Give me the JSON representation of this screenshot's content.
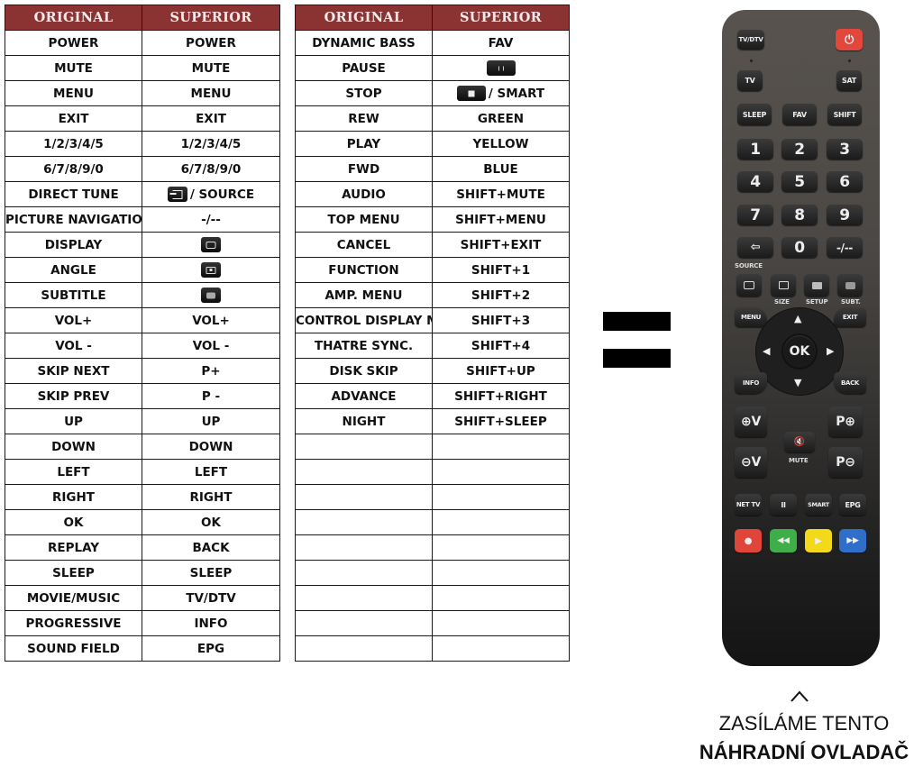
{
  "headers": {
    "original": "ORIGINAL",
    "superior": "SUPERIOR"
  },
  "table_left": [
    {
      "original": "POWER",
      "superior": "POWER"
    },
    {
      "original": "MUTE",
      "superior": "MUTE"
    },
    {
      "original": "MENU",
      "superior": "MENU"
    },
    {
      "original": "EXIT",
      "superior": "EXIT"
    },
    {
      "original": "1/2/3/4/5",
      "superior": "1/2/3/4/5"
    },
    {
      "original": "6/7/8/9/0",
      "superior": "6/7/8/9/0"
    },
    {
      "original": "DIRECT TUNE",
      "superior": "/ SOURCE",
      "superior_icon": "source-key-icon"
    },
    {
      "original": "PICTURE NAVIGATION",
      "superior": "-/--"
    },
    {
      "original": "DISPLAY",
      "superior": "",
      "superior_icon": "display-key-icon"
    },
    {
      "original": "ANGLE",
      "superior": "",
      "superior_icon": "size-key-icon"
    },
    {
      "original": "SUBTITLE",
      "superior": "",
      "superior_icon": "subtitle-key-icon"
    },
    {
      "original": "VOL+",
      "superior": "VOL+"
    },
    {
      "original": "VOL -",
      "superior": "VOL -"
    },
    {
      "original": "SKIP NEXT",
      "superior": "P+"
    },
    {
      "original": "SKIP PREV",
      "superior": "P -"
    },
    {
      "original": "UP",
      "superior": "UP"
    },
    {
      "original": "DOWN",
      "superior": "DOWN"
    },
    {
      "original": "LEFT",
      "superior": "LEFT"
    },
    {
      "original": "RIGHT",
      "superior": "RIGHT"
    },
    {
      "original": "OK",
      "superior": "OK"
    },
    {
      "original": "REPLAY",
      "superior": "BACK"
    },
    {
      "original": "SLEEP",
      "superior": "SLEEP"
    },
    {
      "original": "MOVIE/MUSIC",
      "superior": "TV/DTV"
    },
    {
      "original": "PROGRESSIVE",
      "superior": "INFO"
    },
    {
      "original": "SOUND FIELD",
      "superior": "EPG"
    }
  ],
  "table_right": [
    {
      "original": "DYNAMIC BASS",
      "superior": "FAV"
    },
    {
      "original": "PAUSE",
      "superior": "",
      "superior_icon": "pause-key-icon"
    },
    {
      "original": "STOP",
      "superior": "/ SMART",
      "superior_icon": "stop-key-icon"
    },
    {
      "original": "REW",
      "superior": "GREEN"
    },
    {
      "original": "PLAY",
      "superior": "YELLOW"
    },
    {
      "original": "FWD",
      "superior": "BLUE"
    },
    {
      "original": "AUDIO",
      "superior": "SHIFT+MUTE"
    },
    {
      "original": "TOP MENU",
      "superior": "SHIFT+MENU"
    },
    {
      "original": "CANCEL",
      "superior": "SHIFT+EXIT"
    },
    {
      "original": "FUNCTION",
      "superior": "SHIFT+1"
    },
    {
      "original": "AMP. MENU",
      "superior": "SHIFT+2"
    },
    {
      "original": "CONTROL DISPLAY MENU",
      "superior": "SHIFT+3"
    },
    {
      "original": "THATRE SYNC.",
      "superior": "SHIFT+4"
    },
    {
      "original": "DISK SKIP",
      "superior": "SHIFT+UP"
    },
    {
      "original": "ADVANCE",
      "superior": "SHIFT+RIGHT"
    },
    {
      "original": "NIGHT",
      "superior": "SHIFT+SLEEP"
    },
    {
      "original": "",
      "superior": ""
    },
    {
      "original": "",
      "superior": ""
    },
    {
      "original": "",
      "superior": ""
    },
    {
      "original": "",
      "superior": ""
    },
    {
      "original": "",
      "superior": ""
    },
    {
      "original": "",
      "superior": ""
    },
    {
      "original": "",
      "superior": ""
    },
    {
      "original": "",
      "superior": ""
    },
    {
      "original": "",
      "superior": ""
    }
  ],
  "remote": {
    "buttons": {
      "tvdtv": "TV/DTV",
      "power": "⏻",
      "tv": "TV",
      "sat": "SAT",
      "sleep": "SLEEP",
      "fav": "FAV",
      "shift": "SHIFT",
      "digits": [
        "1",
        "2",
        "3",
        "4",
        "5",
        "6",
        "7",
        "8",
        "9"
      ],
      "source": "⇦",
      "zero": "0",
      "dash": "-/--",
      "menu": "MENU",
      "exit": "EXIT",
      "ok": "OK",
      "info": "INFO",
      "back": "BACK",
      "vol_up": "⊕V",
      "vol_down": "⊖V",
      "p_up": "P⊕",
      "p_down": "P⊖",
      "mute": "🔇",
      "nettv": "NET TV",
      "pause": "II",
      "smart": "SMART",
      "epg": "EPG",
      "red": "●",
      "green": "◀◀",
      "yellow": "▶",
      "blue": "▶▶"
    },
    "labels": {
      "source": "SOURCE",
      "size": "SIZE",
      "setup": "SETUP",
      "subt": "SUBT.",
      "mute": "MUTE"
    },
    "colors": {
      "red": "#e0453a",
      "green": "#3fae49",
      "yellow": "#f2d91a",
      "blue": "#2f6fc9",
      "power": "#e2473b"
    }
  },
  "caption": {
    "line1": "ZASÍLÁME TENTO",
    "line2": "NÁHRADNÍ OVLADAČ"
  },
  "colors": {
    "header_bg": "#8b3333"
  }
}
